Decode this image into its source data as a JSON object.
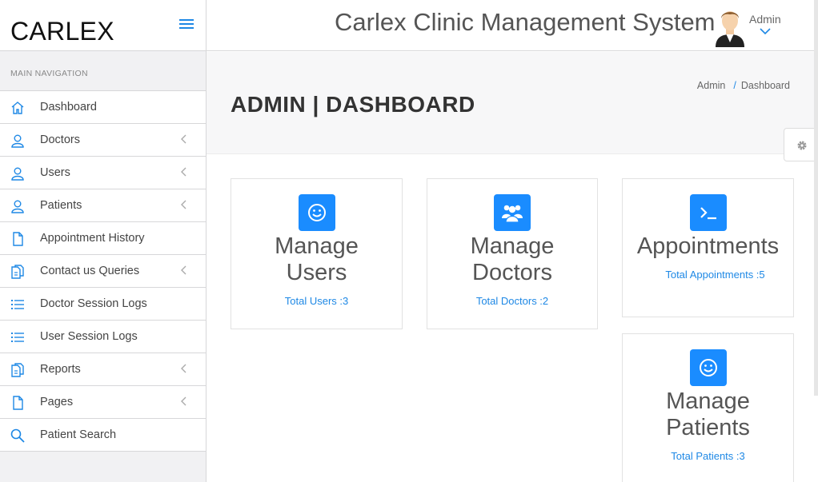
{
  "brand": "CARLEX",
  "app_title": "Carlex Clinic Management System",
  "user": {
    "name": "Admin"
  },
  "nav_heading": "MAIN NAVIGATION",
  "nav_items": [
    {
      "label": "Dashboard",
      "icon": "home-icon",
      "has_submenu": false
    },
    {
      "label": "Doctors",
      "icon": "user-icon",
      "has_submenu": true
    },
    {
      "label": "Users",
      "icon": "user-icon",
      "has_submenu": true
    },
    {
      "label": "Patients",
      "icon": "user-icon",
      "has_submenu": true
    },
    {
      "label": "Appointment History",
      "icon": "file-icon",
      "has_submenu": false
    },
    {
      "label": "Contact us Queries",
      "icon": "files-icon",
      "has_submenu": true
    },
    {
      "label": "Doctor Session Logs",
      "icon": "list-icon",
      "has_submenu": false
    },
    {
      "label": "User Session Logs",
      "icon": "list-icon",
      "has_submenu": false
    },
    {
      "label": "Reports",
      "icon": "files-icon",
      "has_submenu": true
    },
    {
      "label": "Pages",
      "icon": "file-icon",
      "has_submenu": true
    },
    {
      "label": "Patient Search",
      "icon": "search-icon",
      "has_submenu": false
    }
  ],
  "page_title": "ADMIN | DASHBOARD",
  "breadcrumb": {
    "parent": "Admin",
    "separator": "/",
    "current": "Dashboard"
  },
  "cards": {
    "users": {
      "title_line1": "Manage",
      "title_line2": "Users",
      "link": "Total Users :3"
    },
    "doctors": {
      "title_line1": "Manage",
      "title_line2": "Doctors",
      "link": "Total Doctors :2"
    },
    "appointments": {
      "title_line1": "Appointments",
      "link": "Total Appointments :5"
    },
    "patients": {
      "title_line1": "Manage",
      "title_line2": "Patients",
      "link": "Total Patients :3"
    }
  },
  "colors": {
    "accent": "#1a8cff",
    "link": "#1e88e5",
    "sidebar_bg": "#f1f1f3",
    "band_bg": "#f7f7f8"
  }
}
